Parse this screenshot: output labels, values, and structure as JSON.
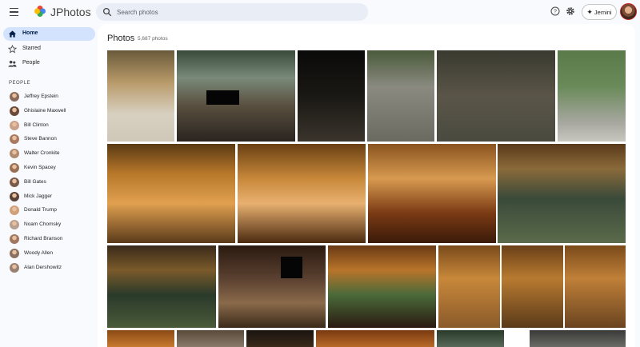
{
  "header": {
    "app_title": "JPhotos",
    "search_placeholder": "Search photos",
    "gemini_label": "Jemini",
    "icons": [
      "menu-icon",
      "jphotos-logo",
      "search-icon",
      "help-icon",
      "settings-icon",
      "gemini-sparkle-icon",
      "profile-avatar"
    ]
  },
  "sidebar": {
    "nav": [
      {
        "label": "Home",
        "icon": "home-icon",
        "active": true
      },
      {
        "label": "Starred",
        "icon": "star-icon",
        "active": false
      },
      {
        "label": "People",
        "icon": "people-icon",
        "active": false
      }
    ],
    "people_heading": "PEOPLE",
    "people": [
      {
        "name": "Jeffrey Epstein",
        "color": "#8a6a5a"
      },
      {
        "name": "Ghislaine Maxwell",
        "color": "#6b4a3a"
      },
      {
        "name": "Bill Clinton",
        "color": "#c9a08a"
      },
      {
        "name": "Steve Bannon",
        "color": "#a87a62"
      },
      {
        "name": "Walter Cronkite",
        "color": "#b08a70"
      },
      {
        "name": "Kevin Spacey",
        "color": "#9a7055"
      },
      {
        "name": "Bill Gates",
        "color": "#7a5a48"
      },
      {
        "name": "Mick Jagger",
        "color": "#5a4236"
      },
      {
        "name": "Donald Trump",
        "color": "#d0a07a"
      },
      {
        "name": "Noam Chomsky",
        "color": "#b8a090"
      },
      {
        "name": "Richard Branson",
        "color": "#a07860"
      },
      {
        "name": "Woody Allen",
        "color": "#8a7060"
      },
      {
        "name": "Alan Dershowitz",
        "color": "#9a8070"
      }
    ]
  },
  "main": {
    "title": "Photos",
    "count": "5,687 photos"
  },
  "colors": {
    "accent": "#d3e3fd",
    "background": "#f8fafd",
    "search_bg": "#e9eef6"
  },
  "photos": [
    {
      "name": "photo-tropical-pavilion",
      "bg": "linear-gradient(180deg,#6a5a3a 0%,#b89a6a 35%,#d8d0c0 70%,#cfc7b8 100%)",
      "redact": null
    },
    {
      "name": "photo-terrace-group",
      "bg": "linear-gradient(180deg,#3a4a3a 0%,#7a8a7a 30%,#5a5040 60%,#2a2420 100%)",
      "redact": true
    },
    {
      "name": "photo-dark-courtyard",
      "bg": "linear-gradient(180deg,#0a0a0a 0%,#1a1814 50%,#3a342c 100%)",
      "redact": null
    },
    {
      "name": "photo-stone-temple",
      "bg": "linear-gradient(180deg,#4a5a3a 0%,#8a8a80 40%,#6a6a60 100%)",
      "redact": null
    },
    {
      "name": "photo-carved-statue",
      "bg": "linear-gradient(180deg,#3a3a30 0%,#5a5548 50%,#4a4a40 100%)",
      "redact": null
    },
    {
      "name": "photo-garden-path",
      "bg": "linear-gradient(180deg,#5a7a4a 0%,#6a8a5a 40%,#a8a8a0 80%,#c8c8c0 100%)",
      "redact": null
    },
    {
      "name": "photo-piano-room-1",
      "bg": "linear-gradient(180deg,#5a3a14 0%,#b8782a 30%,#e0a050 60%,#5a3a1a 100%)",
      "redact": null
    },
    {
      "name": "photo-piano-room-2",
      "bg": "linear-gradient(180deg,#6a4014 0%,#c8883a 35%,#e8b070 60%,#4a2a10 100%)",
      "redact": null
    },
    {
      "name": "photo-piano-closeup",
      "bg": "linear-gradient(180deg,#8a5420 0%,#d89a50 35%,#7a3a14 70%,#3a1a0a 100%)",
      "redact": null
    },
    {
      "name": "photo-pool-night-1",
      "bg": "linear-gradient(180deg,#5a3a1a 0%,#8a6a3a 25%,#3a4a3a 55%,#5a6a4a 100%)",
      "redact": null
    },
    {
      "name": "photo-pool-night-2",
      "bg": "linear-gradient(180deg,#3a2a1a 0%,#7a5a2a 30%,#2a3a2a 60%,#4a5a3a 100%)",
      "redact": null
    },
    {
      "name": "photo-hot-tub",
      "bg": "linear-gradient(180deg,#2a1a10 0%,#5a4030 40%,#8a6a4a 70%,#3a2a1a 100%)",
      "redact": true
    },
    {
      "name": "photo-dinner-guests",
      "bg": "linear-gradient(180deg,#6a3a14 0%,#b8742a 30%,#4a6a3a 60%,#2a1a10 100%)",
      "redact": null
    },
    {
      "name": "photo-hall-group-1",
      "bg": "linear-gradient(180deg,#7a4a1a 0%,#c8883a 40%,#8a5a2a 100%)",
      "redact": null
    },
    {
      "name": "photo-hall-group-2",
      "bg": "linear-gradient(180deg,#6a4018 0%,#b87a30 40%,#5a3a1a 100%)",
      "redact": null
    },
    {
      "name": "photo-hall-group-3",
      "bg": "linear-gradient(180deg,#7a4a1a 0%,#c08038 40%,#6a4420 100%)",
      "redact": null
    },
    {
      "name": "photo-row4-1",
      "bg": "linear-gradient(180deg,#8a4a14 0%,#c87a30 100%)",
      "redact": null
    },
    {
      "name": "photo-row4-2",
      "bg": "linear-gradient(180deg,#5a4a3a 0%,#8a7a6a 100%)",
      "redact": null
    },
    {
      "name": "photo-row4-3",
      "bg": "linear-gradient(180deg,#1a1410 0%,#3a2a1a 100%)",
      "redact": null
    },
    {
      "name": "photo-row4-4",
      "bg": "linear-gradient(180deg,#7a3a10 0%,#b86a28 100%)",
      "redact": null
    },
    {
      "name": "photo-row4-5",
      "bg": "linear-gradient(180deg,#2a3a2a 0%,#5a6a5a 100%)",
      "redact": null
    },
    {
      "name": "photo-row4-6",
      "bg": "linear-gradient(180deg,#3a3a38 0%,#6a6a66 100%)",
      "redact": null
    }
  ]
}
